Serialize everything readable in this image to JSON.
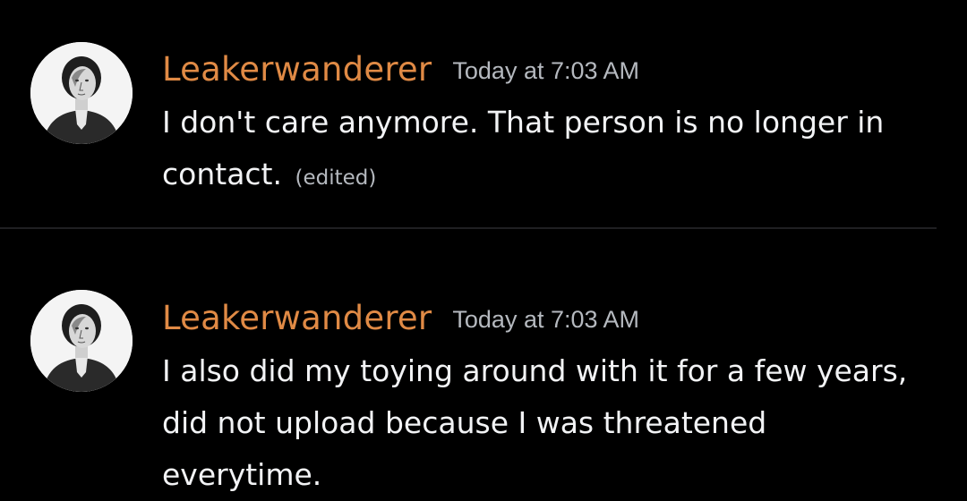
{
  "messages": [
    {
      "username": "Leakerwanderer",
      "timestamp": "Today at 7:03 AM",
      "text_line1": "I don't care anymore. That person is no longer in",
      "text_line2": "contact.",
      "edited": "(edited)",
      "avatar": "engraved-portrait-avatar"
    },
    {
      "username": "Leakerwanderer",
      "timestamp": "Today at 7:03 AM",
      "text_line1": "I also did my toying around with it for a few years,",
      "text_line2": "did not upload because I was threatened",
      "text_line3": "everytime.",
      "avatar": "engraved-portrait-avatar"
    }
  ],
  "colors": {
    "background": "#000000",
    "username": "#e08a45",
    "timestamp": "#b5b9bf",
    "message_text": "#f2f3f5"
  }
}
